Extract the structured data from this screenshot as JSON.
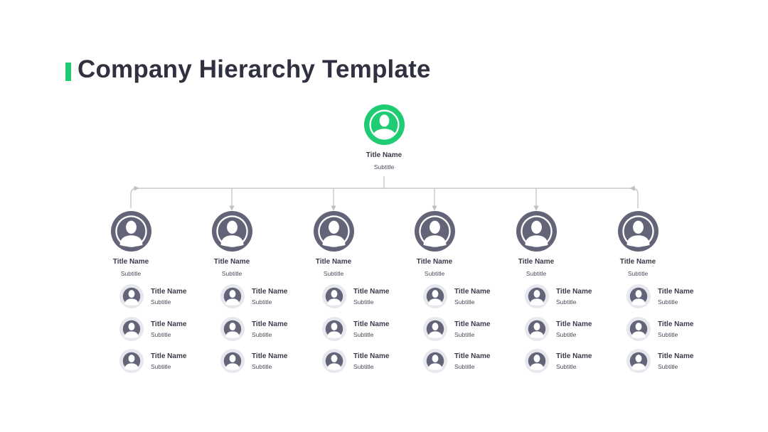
{
  "title": "Company Hierarchy Template",
  "colors": {
    "accent": "#1fcc74",
    "manager_avatar": "#636478",
    "employee_avatar_bg": "#e7e8ee",
    "connector": "#c8c9cf"
  },
  "root": {
    "name": "Title Name",
    "subtitle": "Subtitle",
    "icon": "person-icon"
  },
  "managers": [
    {
      "name": "Title Name",
      "subtitle": "Subtitle",
      "reports": [
        {
          "name": "Title Name",
          "subtitle": "Subtitle"
        },
        {
          "name": "Title Name",
          "subtitle": "Subtitle"
        },
        {
          "name": "Title Name",
          "subtitle": "Subtitle"
        }
      ]
    },
    {
      "name": "Title Name",
      "subtitle": "Subtitle",
      "reports": [
        {
          "name": "Title Name",
          "subtitle": "Subtitle"
        },
        {
          "name": "Title Name",
          "subtitle": "Subtitle"
        },
        {
          "name": "Title Name",
          "subtitle": "Subtitle"
        }
      ]
    },
    {
      "name": "Title Name",
      "subtitle": "Subtitle",
      "reports": [
        {
          "name": "Title Name",
          "subtitle": "Subtitle"
        },
        {
          "name": "Title Name",
          "subtitle": "Subtitle"
        },
        {
          "name": "Title Name",
          "subtitle": "Subtitle"
        }
      ]
    },
    {
      "name": "Title Name",
      "subtitle": "Subtitle",
      "reports": [
        {
          "name": "Title Name",
          "subtitle": "Subtitle"
        },
        {
          "name": "Title Name",
          "subtitle": "Subtitle"
        },
        {
          "name": "Title Name",
          "subtitle": "Subtitle"
        }
      ]
    },
    {
      "name": "Title Name",
      "subtitle": "Subtitle",
      "reports": [
        {
          "name": "Title Name",
          "subtitle": "Subtitle"
        },
        {
          "name": "Title Name",
          "subtitle": "Subtitle"
        },
        {
          "name": "Title Name",
          "subtitle": "Subtitle"
        }
      ]
    },
    {
      "name": "Title Name",
      "subtitle": "Subtitle",
      "reports": [
        {
          "name": "Title Name",
          "subtitle": "Subtitle"
        },
        {
          "name": "Title Name",
          "subtitle": "Subtitle"
        },
        {
          "name": "Title Name",
          "subtitle": "Subtitle"
        }
      ]
    }
  ]
}
